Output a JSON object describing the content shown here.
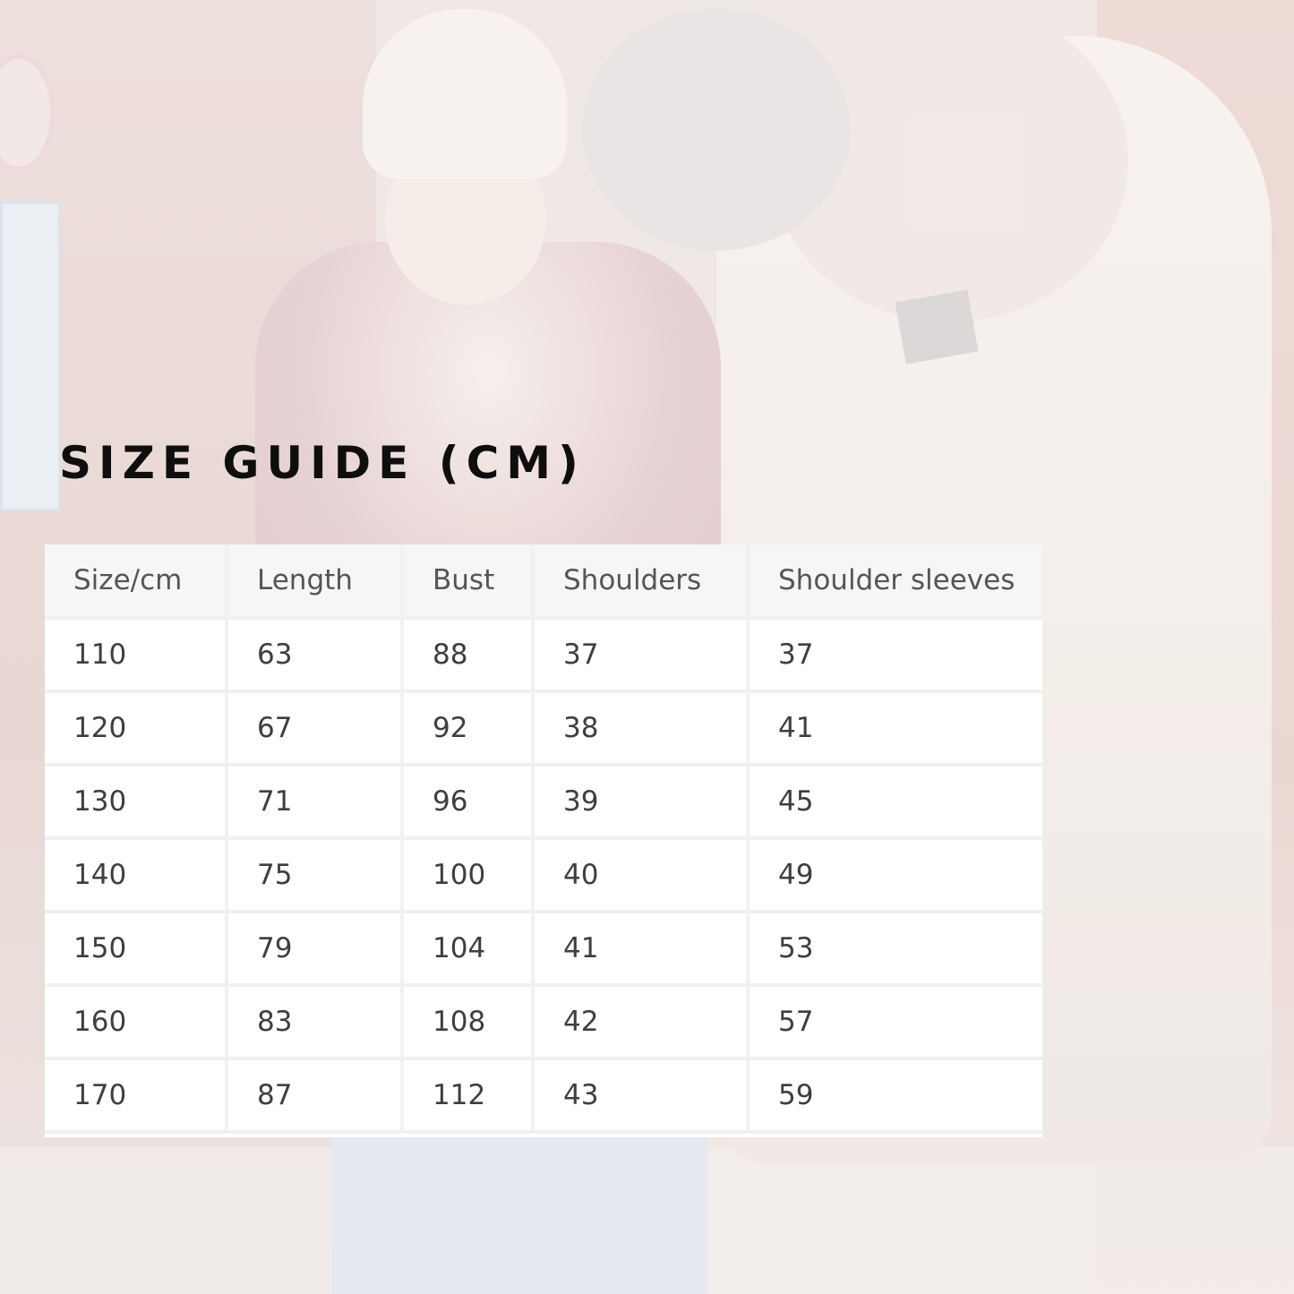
{
  "title": "SIZE GUIDE (CM)",
  "table": {
    "headers": [
      "Size/cm",
      "Length",
      "Bust",
      "Shoulders",
      "Shoulder sleeves"
    ],
    "rows": [
      [
        "110",
        "63",
        "88",
        "37",
        "37"
      ],
      [
        "120",
        "67",
        "92",
        "38",
        "41"
      ],
      [
        "130",
        "71",
        "96",
        "39",
        "45"
      ],
      [
        "140",
        "75",
        "100",
        "40",
        "49"
      ],
      [
        "150",
        "79",
        "104",
        "41",
        "53"
      ],
      [
        "160",
        "83",
        "108",
        "42",
        "57"
      ],
      [
        "170",
        "87",
        "112",
        "43",
        "59"
      ]
    ]
  }
}
